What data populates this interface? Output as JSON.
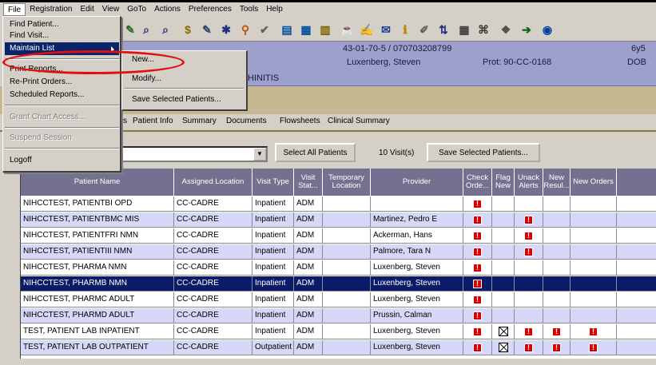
{
  "menubar": [
    "File",
    "Registration",
    "Edit",
    "View",
    "GoTo",
    "Actions",
    "Preferences",
    "Tools",
    "Help"
  ],
  "file_menu": {
    "items": [
      "Find Patient...",
      "Find Visit...",
      "Maintain List",
      "Print Reports...",
      "Re-Print Orders...",
      "Scheduled Reports...",
      "Grant Chart Access...",
      "Suspend Session",
      "Logoff"
    ],
    "highlighted": "Maintain List"
  },
  "submenu": {
    "items": [
      "New...",
      "Modify...",
      "Save Selected Patients..."
    ]
  },
  "banner": {
    "mrn": "43-01-70-5 / 070703208799",
    "name": "Luxenberg, Steven",
    "protocol": "Prot: 90-CC-0168",
    "right1": "6y5",
    "right2": "DOB",
    "dx_fragment": "HINITIS"
  },
  "tabs": [
    "s",
    "Patient Info",
    "Summary",
    "Documents",
    "Flowsheets",
    "Clinical Summary"
  ],
  "filter": {
    "select_all": "Select All Patients",
    "visit_count": "10 Visit(s)",
    "save_selected": "Save Selected Patients..."
  },
  "grid": {
    "headers": [
      "Patient Name",
      "Assigned Location",
      "Visit Type",
      "Visit Stat...",
      "Temporary Location",
      "Provider",
      "Check Orde...",
      "Flag New",
      "Unack Alerts",
      "New Resul...",
      "New Orders"
    ],
    "rows": [
      {
        "name": "NIHCCTEST, PATIENTBI OPD",
        "loc": "CC-CADRE",
        "type": "Inpatient",
        "stat": "ADM",
        "temp": "",
        "prov": "",
        "check": true,
        "flag": false,
        "unack": false,
        "newres": false,
        "neword": false
      },
      {
        "name": "NIHCCTEST, PATIENTBMC MIS",
        "loc": "CC-CADRE",
        "type": "Inpatient",
        "stat": "ADM",
        "temp": "",
        "prov": "Martinez, Pedro E",
        "check": true,
        "flag": false,
        "unack": true,
        "newres": false,
        "neword": false
      },
      {
        "name": "NIHCCTEST, PATIENTFRI NMN",
        "loc": "CC-CADRE",
        "type": "Inpatient",
        "stat": "ADM",
        "temp": "",
        "prov": "Ackerman, Hans",
        "check": true,
        "flag": false,
        "unack": true,
        "newres": false,
        "neword": false
      },
      {
        "name": "NIHCCTEST, PATIENTIII NMN",
        "loc": "CC-CADRE",
        "type": "Inpatient",
        "stat": "ADM",
        "temp": "",
        "prov": "Palmore, Tara N",
        "check": true,
        "flag": false,
        "unack": true,
        "newres": false,
        "neword": false
      },
      {
        "name": "NIHCCTEST, PHARMA NMN",
        "loc": "CC-CADRE",
        "type": "Inpatient",
        "stat": "ADM",
        "temp": "",
        "prov": "Luxenberg, Steven",
        "check": true,
        "flag": false,
        "unack": false,
        "newres": false,
        "neword": false
      },
      {
        "name": "NIHCCTEST, PHARMB NMN",
        "loc": "CC-CADRE",
        "type": "Inpatient",
        "stat": "ADM",
        "temp": "",
        "prov": "Luxenberg, Steven",
        "check": true,
        "flag": false,
        "unack": false,
        "newres": false,
        "neword": false
      },
      {
        "name": "NIHCCTEST, PHARMC ADULT",
        "loc": "CC-CADRE",
        "type": "Inpatient",
        "stat": "ADM",
        "temp": "",
        "prov": "Luxenberg, Steven",
        "check": true,
        "flag": false,
        "unack": false,
        "newres": false,
        "neword": false
      },
      {
        "name": "NIHCCTEST, PHARMD ADULT",
        "loc": "CC-CADRE",
        "type": "Inpatient",
        "stat": "ADM",
        "temp": "",
        "prov": "Prussin, Calman",
        "check": true,
        "flag": false,
        "unack": false,
        "newres": false,
        "neword": false
      },
      {
        "name": "TEST, PATIENT LAB INPATIENT",
        "loc": "CC-CADRE",
        "type": "Inpatient",
        "stat": "ADM",
        "temp": "",
        "prov": "Luxenberg, Steven",
        "check": true,
        "flag": true,
        "unack": true,
        "newres": true,
        "neword": true
      },
      {
        "name": "TEST, PATIENT LAB OUTPATIENT",
        "loc": "CC-CADRE",
        "type": "Outpatient",
        "stat": "ADM",
        "temp": "",
        "prov": "Luxenberg, Steven",
        "check": true,
        "flag": true,
        "unack": true,
        "newres": true,
        "neword": true
      }
    ],
    "selected_row": 5
  },
  "colors": {
    "selected_row": "#0c1b68",
    "alt_row": "#d6d8f8",
    "header": "#73718f",
    "alert": "#d80000",
    "annotation": "#e01010"
  },
  "toolbar_icons": [
    "patient-icon",
    "find-icon",
    "search-icon",
    "pharmacy-icon",
    "order-icon",
    "star-icon",
    "person-icon",
    "check-icon",
    "chart-icon",
    "lab-icon",
    "document-icon",
    "cup-icon",
    "sign-icon",
    "note-icon",
    "info-icon",
    "pin-icon",
    "sort-icon",
    "grid-icon",
    "lock-icon",
    "tree-icon",
    "exit-icon",
    "web-icon"
  ]
}
